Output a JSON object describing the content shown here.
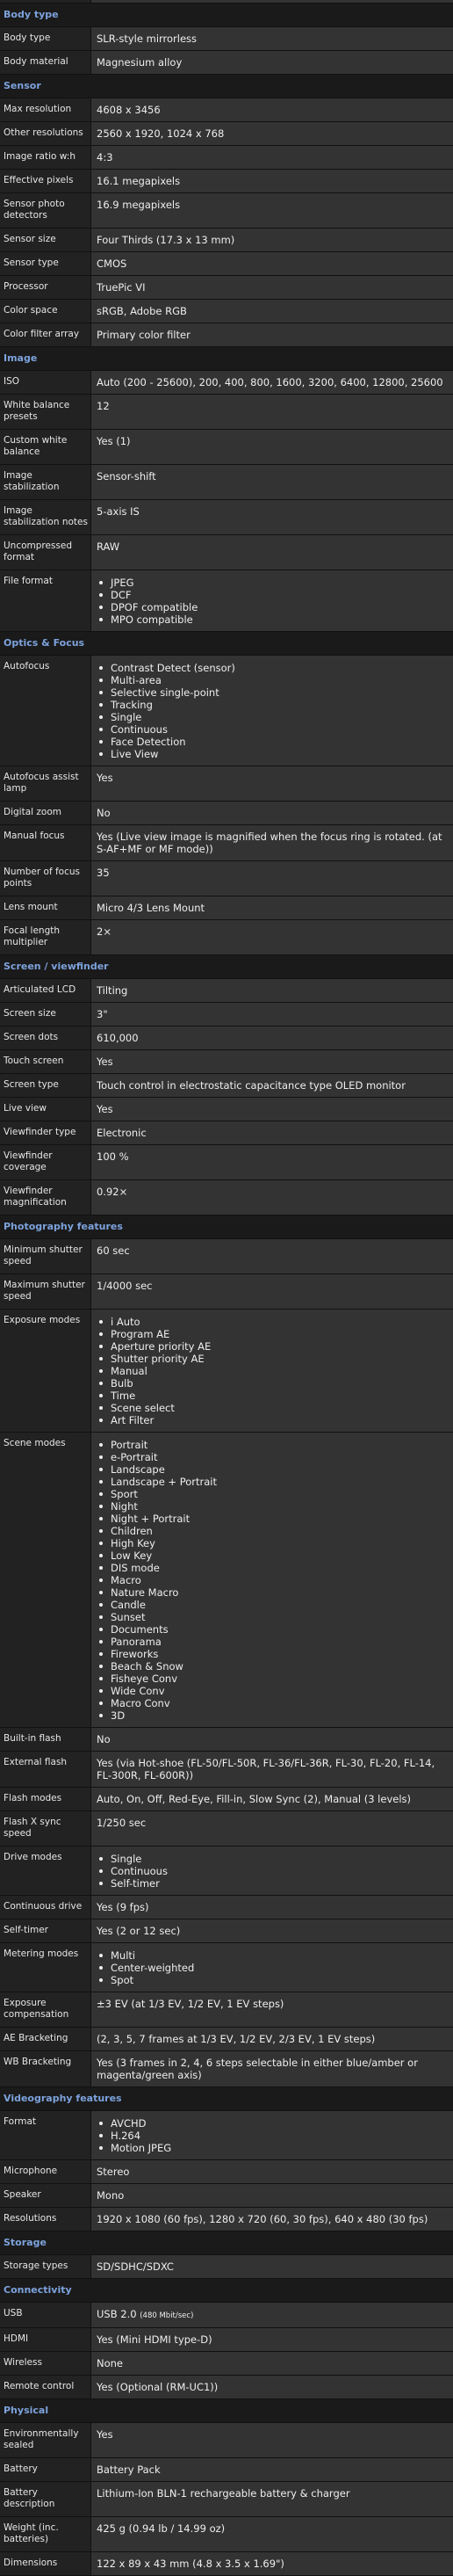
{
  "colors": {
    "section_header_text": "#7da2dc",
    "section_header_bg": "#1a1a1a",
    "label_bg": "#222222",
    "value_bg": "#333333"
  },
  "sections": [
    {
      "title": "Body type",
      "rows": [
        {
          "label": "Body type",
          "value": "SLR-style mirrorless"
        },
        {
          "label": "Body material",
          "value": "Magnesium alloy"
        }
      ]
    },
    {
      "title": "Sensor",
      "rows": [
        {
          "label": "Max resolution",
          "value": "4608 x 3456"
        },
        {
          "label": "Other resolutions",
          "value": "2560 x 1920, 1024 x 768"
        },
        {
          "label": "Image ratio w:h",
          "value": "4:3"
        },
        {
          "label": "Effective pixels",
          "value": "16.1 megapixels"
        },
        {
          "label": "Sensor photo detectors",
          "value": "16.9 megapixels"
        },
        {
          "label": "Sensor size",
          "value": "Four Thirds (17.3 x 13 mm)"
        },
        {
          "label": "Sensor type",
          "value": "CMOS"
        },
        {
          "label": "Processor",
          "value": "TruePic VI"
        },
        {
          "label": "Color space",
          "value": "sRGB, Adobe RGB"
        },
        {
          "label": "Color filter array",
          "value": "Primary color filter"
        }
      ]
    },
    {
      "title": "Image",
      "rows": [
        {
          "label": "ISO",
          "value": "Auto (200 - 25600), 200, 400, 800, 1600, 3200, 6400, 12800, 25600"
        },
        {
          "label": "White balance presets",
          "value": "12"
        },
        {
          "label": "Custom white balance",
          "value": "Yes (1)"
        },
        {
          "label": "Image stabilization",
          "value": "Sensor-shift"
        },
        {
          "label": "Image stabilization notes",
          "value": "5-axis IS"
        },
        {
          "label": "Uncompressed format",
          "value": "RAW"
        },
        {
          "label": "File format",
          "list": [
            "JPEG",
            "DCF",
            "DPOF compatible",
            "MPO compatible"
          ]
        }
      ]
    },
    {
      "title": "Optics & Focus",
      "rows": [
        {
          "label": "Autofocus",
          "list": [
            "Contrast Detect (sensor)",
            "Multi-area",
            "Selective single-point",
            "Tracking",
            "Single",
            "Continuous",
            "Face Detection",
            "Live View"
          ]
        },
        {
          "label": "Autofocus assist lamp",
          "value": "Yes"
        },
        {
          "label": "Digital zoom",
          "value": "No"
        },
        {
          "label": "Manual focus",
          "value": "Yes (Live view image is magnified when the focus ring is rotated. (at S-AF+MF or MF mode))"
        },
        {
          "label": "Number of focus points",
          "value": "35"
        },
        {
          "label": "Lens mount",
          "value": "Micro 4/3 Lens Mount"
        },
        {
          "label": "Focal length multiplier",
          "value": "2×"
        }
      ]
    },
    {
      "title": "Screen / viewfinder",
      "rows": [
        {
          "label": "Articulated LCD",
          "value": "Tilting"
        },
        {
          "label": "Screen size",
          "value": "3\""
        },
        {
          "label": "Screen dots",
          "value": "610,000"
        },
        {
          "label": "Touch screen",
          "value": "Yes"
        },
        {
          "label": "Screen type",
          "value": "Touch control in electrostatic capacitance type OLED monitor"
        },
        {
          "label": "Live view",
          "value": "Yes"
        },
        {
          "label": "Viewfinder type",
          "value": "Electronic"
        },
        {
          "label": "Viewfinder coverage",
          "value": "100 %"
        },
        {
          "label": "Viewfinder magnification",
          "value": "0.92×"
        }
      ]
    },
    {
      "title": "Photography features",
      "rows": [
        {
          "label": "Minimum shutter speed",
          "value": "60 sec"
        },
        {
          "label": "Maximum shutter speed",
          "value": "1/4000 sec"
        },
        {
          "label": "Exposure modes",
          "list": [
            "i Auto",
            "Program AE",
            "Aperture priority AE",
            "Shutter priority AE",
            "Manual",
            "Bulb",
            "Time",
            "Scene select",
            "Art Filter"
          ]
        },
        {
          "label": "Scene modes",
          "list": [
            "Portrait",
            "e-Portrait",
            "Landscape",
            "Landscape + Portrait",
            "Sport",
            "Night",
            "Night + Portrait",
            "Children",
            "High Key",
            "Low Key",
            "DIS mode",
            "Macro",
            "Nature Macro",
            "Candle",
            "Sunset",
            "Documents",
            "Panorama",
            "Fireworks",
            "Beach & Snow",
            "Fisheye Conv",
            "Wide Conv",
            "Macro Conv",
            "3D"
          ]
        },
        {
          "label": "Built-in flash",
          "value": "No"
        },
        {
          "label": "External flash",
          "value": "Yes (via Hot-shoe (FL-50/FL-50R, FL-36/FL-36R, FL-30, FL-20, FL-14, FL-300R, FL-600R))"
        },
        {
          "label": "Flash modes",
          "value": "Auto, On, Off, Red-Eye, Fill-in, Slow Sync (2), Manual (3 levels)"
        },
        {
          "label": "Flash X sync speed",
          "value": "1/250 sec"
        },
        {
          "label": "Drive modes",
          "list": [
            "Single",
            "Continuous",
            "Self-timer"
          ]
        },
        {
          "label": "Continuous drive",
          "value": "Yes (9 fps)"
        },
        {
          "label": "Self-timer",
          "value": "Yes (2 or 12 sec)"
        },
        {
          "label": "Metering modes",
          "list": [
            "Multi",
            "Center-weighted",
            "Spot"
          ]
        },
        {
          "label": "Exposure compensation",
          "value": "±3 EV (at 1/3 EV, 1/2 EV, 1 EV steps)"
        },
        {
          "label": "AE Bracketing",
          "value": "(2, 3, 5, 7 frames at 1/3 EV, 1/2 EV, 2/3 EV, 1 EV steps)"
        },
        {
          "label": "WB Bracketing",
          "value": "Yes (3 frames in 2, 4, 6 steps selectable in either blue/amber or magenta/green axis)"
        }
      ]
    },
    {
      "title": "Videography features",
      "rows": [
        {
          "label": "Format",
          "list": [
            "AVCHD",
            "H.264",
            "Motion JPEG"
          ]
        },
        {
          "label": "Microphone",
          "value": "Stereo"
        },
        {
          "label": "Speaker",
          "value": "Mono"
        },
        {
          "label": "Resolutions",
          "value": "1920 x 1080 (60 fps), 1280 x 720 (60, 30 fps), 640 x 480 (30 fps)"
        }
      ]
    },
    {
      "title": "Storage",
      "rows": [
        {
          "label": "Storage types",
          "value": "SD/SDHC/SDXC"
        }
      ]
    },
    {
      "title": "Connectivity",
      "rows": [
        {
          "label": "USB",
          "value": "USB 2.0",
          "value_small": "(480 Mbit/sec)"
        },
        {
          "label": "HDMI",
          "value": "Yes (Mini HDMI type-D)"
        },
        {
          "label": "Wireless",
          "value": "None"
        },
        {
          "label": "Remote control",
          "value": "Yes (Optional (RM-UC1))"
        }
      ]
    },
    {
      "title": "Physical",
      "rows": [
        {
          "label": "Environmentally sealed",
          "value": "Yes"
        },
        {
          "label": "Battery",
          "value": "Battery Pack"
        },
        {
          "label": "Battery description",
          "value": "Lithium-Ion BLN-1 rechargeable battery & charger"
        },
        {
          "label": "Weight (inc. batteries)",
          "value": "425 g (0.94 lb / 14.99 oz)"
        },
        {
          "label": "Dimensions",
          "value": "122 x 89 x 43 mm (4.8 x 3.5 x 1.69\")"
        }
      ]
    }
  ]
}
